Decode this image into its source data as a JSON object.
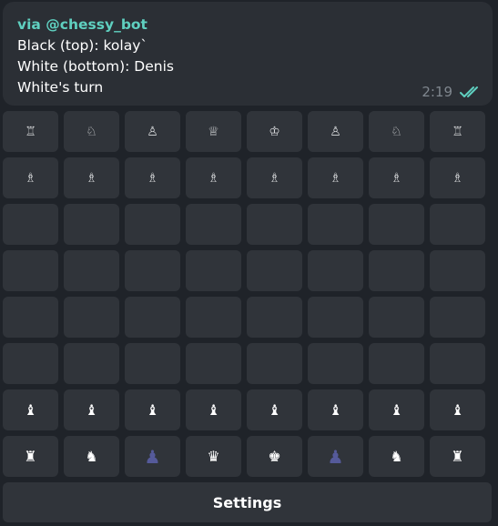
{
  "message": {
    "via": "via @chessy_bot",
    "black_line": "Black (top): kolay`",
    "white_line": "White (bottom): Denis",
    "turn_line": "White's turn",
    "time": "2:19",
    "read_status": "double-check-icon"
  },
  "board": {
    "rows": [
      [
        "♖",
        "♘",
        "♙",
        "♕",
        "♔",
        "♙",
        "♘",
        "♖"
      ],
      [
        "♗",
        "♗",
        "♗",
        "♗",
        "♗",
        "♗",
        "♗",
        "♗"
      ],
      [
        "",
        "",
        "",
        "",
        "",
        "",
        "",
        ""
      ],
      [
        "",
        "",
        "",
        "",
        "",
        "",
        "",
        ""
      ],
      [
        "",
        "",
        "",
        "",
        "",
        "",
        "",
        ""
      ],
      [
        "",
        "",
        "",
        "",
        "",
        "",
        "",
        ""
      ],
      [
        "♝",
        "♝",
        "♝",
        "♝",
        "♝",
        "♝",
        "♝",
        "♝"
      ],
      [
        "♜",
        "♞",
        "♟",
        "♛",
        "♚",
        "♟",
        "♞",
        "♜"
      ]
    ]
  },
  "settings_label": "Settings",
  "colors": {
    "accent": "#5fd0c0",
    "cell": "#30343a",
    "bubble": "#2b2f35",
    "background": "#1f2329"
  }
}
